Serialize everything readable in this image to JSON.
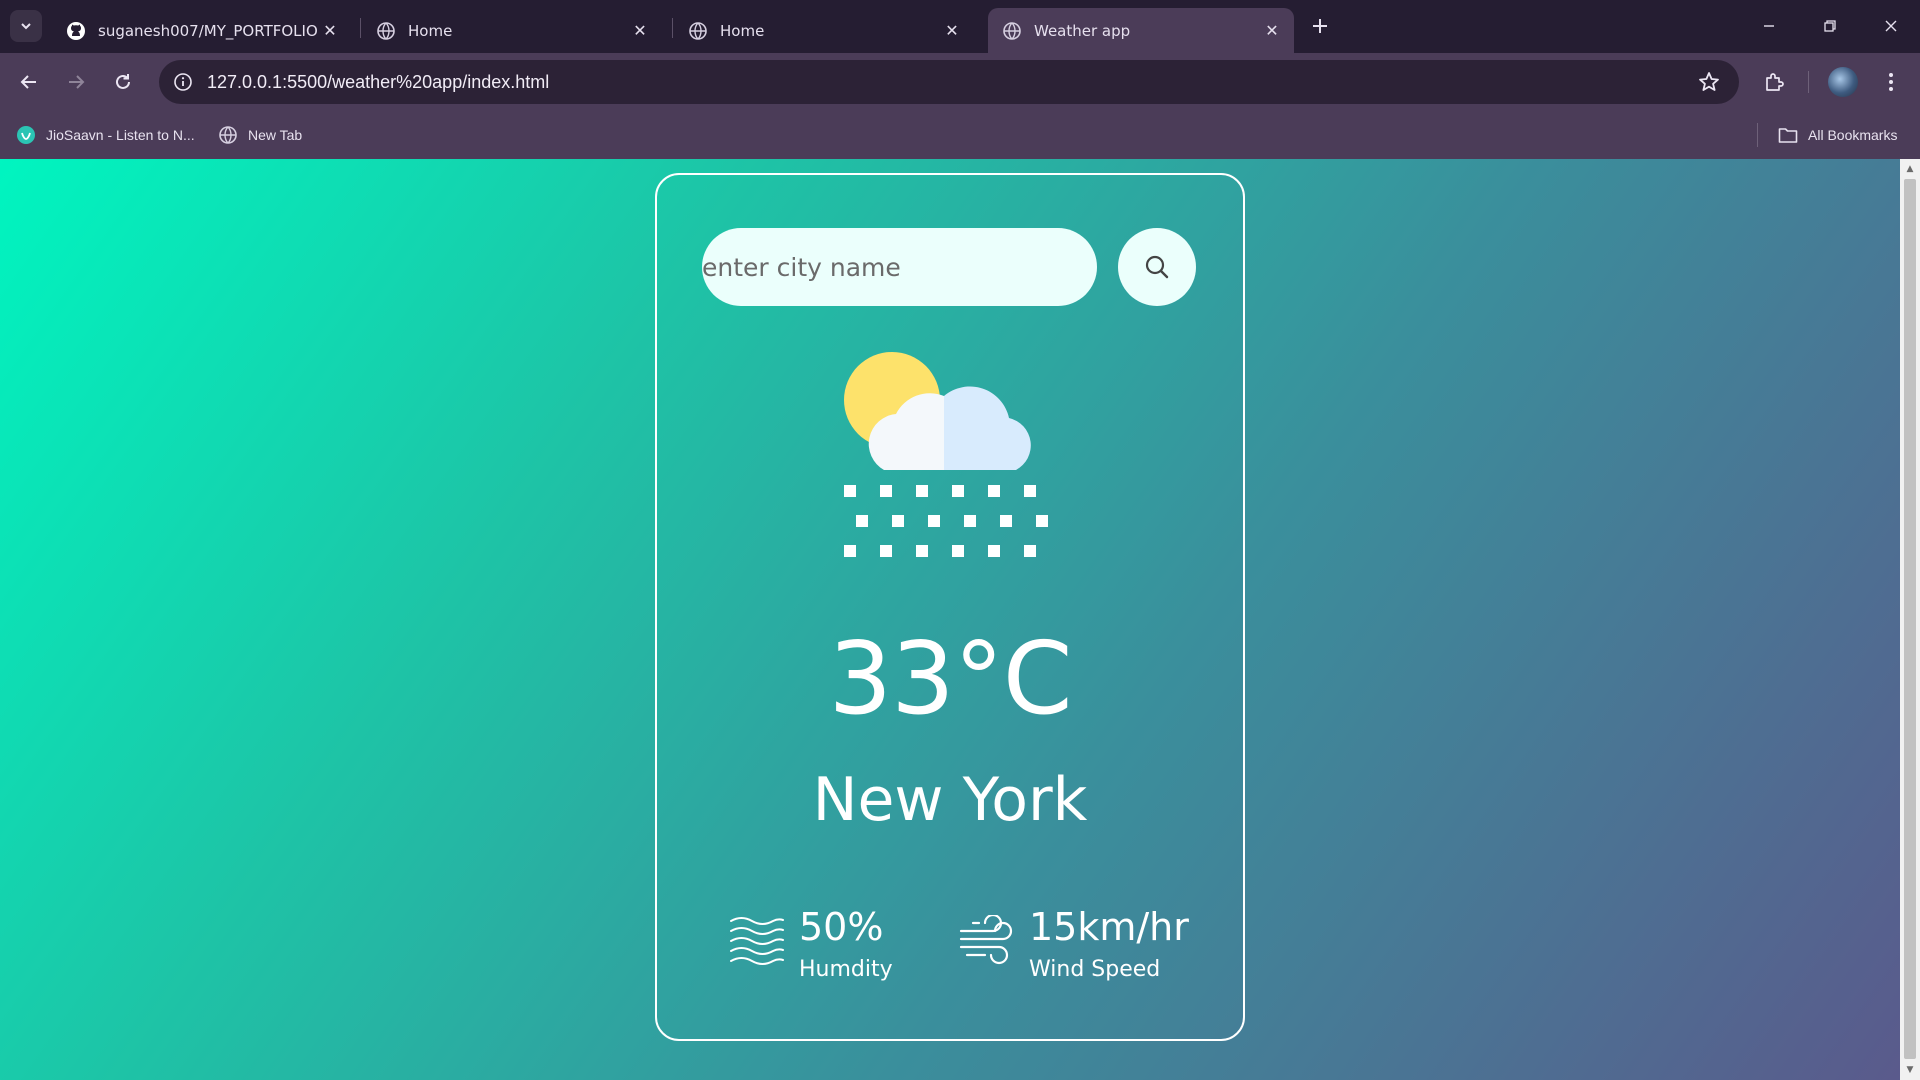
{
  "browser": {
    "tabs": [
      {
        "title": "suganesh007/MY_PORTFOLIO: 💻",
        "favicon": "github-icon",
        "active": false
      },
      {
        "title": "Home",
        "favicon": "globe-icon",
        "active": false
      },
      {
        "title": "Home",
        "favicon": "globe-icon",
        "active": false
      },
      {
        "title": "Weather app",
        "favicon": "globe-icon",
        "active": true
      }
    ],
    "url": "127.0.0.1:5500/weather%20app/index.html",
    "bookmarks": [
      {
        "label": "JioSaavn - Listen to N...",
        "icon": "jiosaavn-icon"
      },
      {
        "label": "New Tab",
        "icon": "globe-icon"
      }
    ],
    "all_bookmarks_label": "All Bookmarks"
  },
  "app": {
    "search": {
      "placeholder": "enter city name",
      "value": ""
    },
    "weather": {
      "icon": "snow-sun-cloud-icon",
      "temperature": "33°C",
      "city": "New York",
      "humidity": {
        "value": "50%",
        "label": "Humdity",
        "icon": "humidity-waves-icon"
      },
      "wind": {
        "value": "15km/hr",
        "label": "Wind Speed",
        "icon": "wind-icon"
      }
    },
    "colors": {
      "gradient_start": "#00f5c0",
      "gradient_end": "#5a5a8c",
      "input_bg": "#ebfffc",
      "sun": "#fde26b",
      "cloud_light": "#f4f8fb",
      "cloud_shade": "#d8ebfd"
    }
  }
}
